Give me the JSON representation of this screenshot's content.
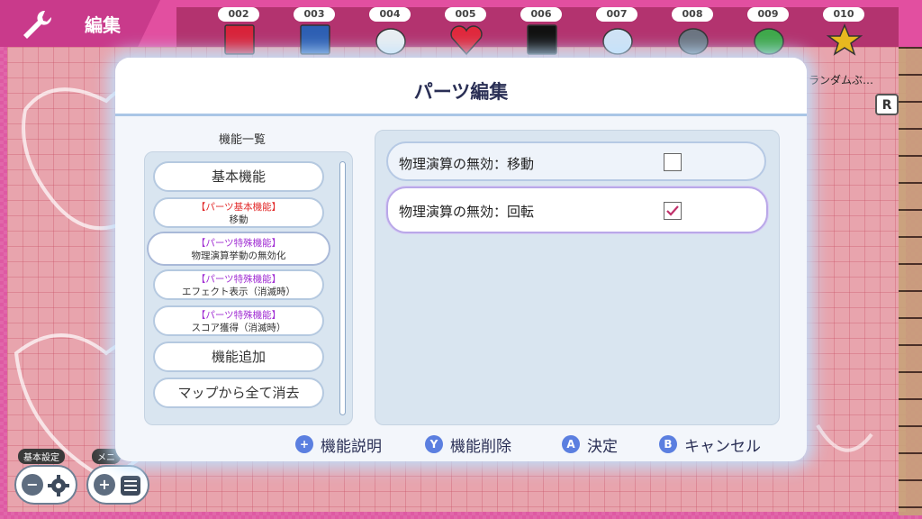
{
  "header": {
    "title": "編集"
  },
  "parts": [
    {
      "num": "002",
      "icon": "red-block-icon"
    },
    {
      "num": "003",
      "icon": "gear-block-icon"
    },
    {
      "num": "004",
      "icon": "seal-icon"
    },
    {
      "num": "005",
      "icon": "heart-icon"
    },
    {
      "num": "006",
      "icon": "black-frame-icon"
    },
    {
      "num": "007",
      "icon": "angel-dog-icon"
    },
    {
      "num": "008",
      "icon": "wolf-icon"
    },
    {
      "num": "009",
      "icon": "frog-icon"
    },
    {
      "num": "010",
      "icon": "star-icon"
    }
  ],
  "random_label": "ランダムぶ…",
  "r_button": "R",
  "modal": {
    "title": "パーツ編集",
    "list_caption": "機能一覧",
    "list_items": [
      {
        "tag": "",
        "label": "基本機能"
      },
      {
        "tag": "【パーツ基本機能】",
        "label": "移動"
      },
      {
        "tag": "【パーツ特殊機能】",
        "label": "物理演算挙動の無効化"
      },
      {
        "tag": "【パーツ特殊機能】",
        "label": "エフェクト表示（消滅時）"
      },
      {
        "tag": "【パーツ特殊機能】",
        "label": "スコア獲得（消滅時）"
      },
      {
        "tag": "",
        "label": "機能追加"
      },
      {
        "tag": "",
        "label": "マップから全て消去"
      }
    ],
    "options": [
      {
        "label": "物理演算の無効：移動",
        "checked": false
      },
      {
        "label": "物理演算の無効：回転",
        "checked": true
      }
    ],
    "footer": [
      {
        "key": "+",
        "label": "機能説明"
      },
      {
        "key": "Y",
        "label": "機能削除"
      },
      {
        "key": "A",
        "label": "決定"
      },
      {
        "key": "B",
        "label": "キャンセル"
      }
    ]
  },
  "bottom": {
    "settings_label": "基本設定",
    "menu_label": "メニ",
    "minus": "−",
    "plus": "+"
  },
  "colors": {
    "accent": "#5b7fe0",
    "tag_red": "#e22a2a",
    "tag_purple": "#a12fd3"
  }
}
